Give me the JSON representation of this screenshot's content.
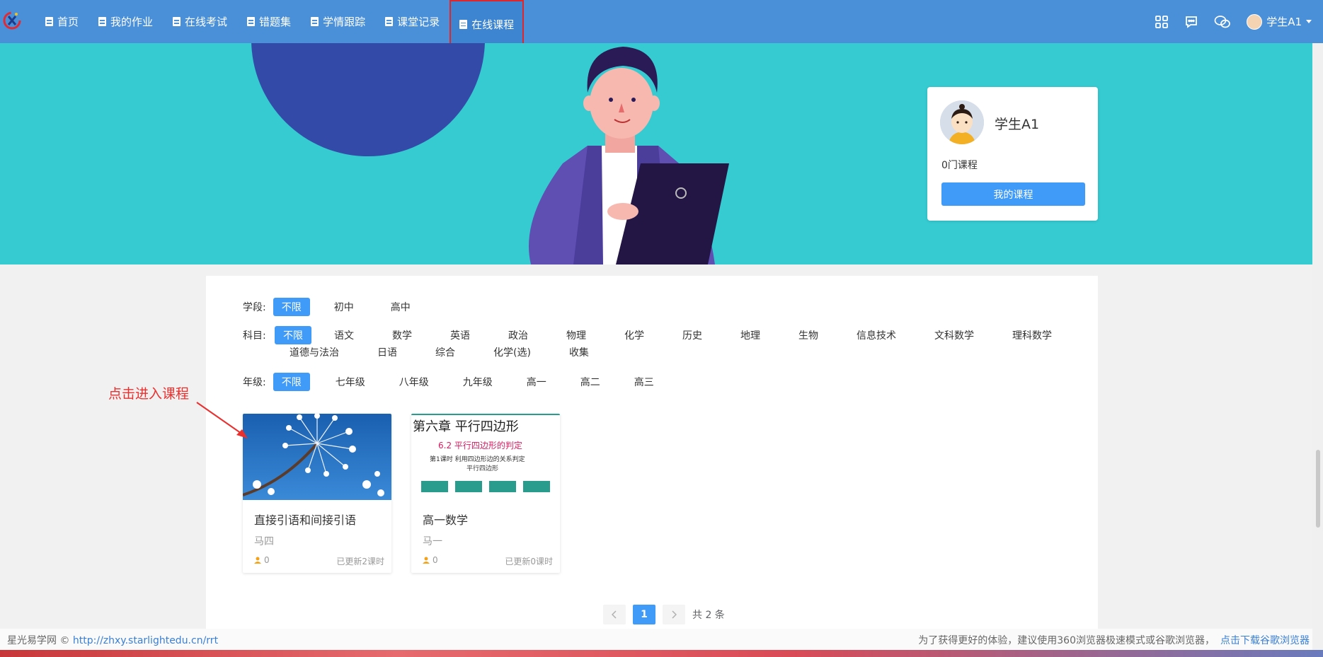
{
  "nav": {
    "items": [
      {
        "label": "首页"
      },
      {
        "label": "我的作业"
      },
      {
        "label": "在线考试"
      },
      {
        "label": "错题集"
      },
      {
        "label": "学情跟踪"
      },
      {
        "label": "课堂记录"
      },
      {
        "label": "在线课程",
        "active": true
      }
    ],
    "user_name": "学生A1"
  },
  "profile": {
    "name": "学生A1",
    "course_count": "0门课程",
    "my_courses_button": "我的课程"
  },
  "filters": {
    "stage": {
      "label": "学段:",
      "options": [
        "不限",
        "初中",
        "高中"
      ]
    },
    "subject": {
      "label": "科目:",
      "options": [
        "不限",
        "语文",
        "数学",
        "英语",
        "政治",
        "物理",
        "化学",
        "历史",
        "地理",
        "生物",
        "信息技术",
        "文科数学",
        "理科数学"
      ],
      "options_row2": [
        "道德与法治",
        "日语",
        "综合",
        "化学(选)",
        "收集"
      ]
    },
    "grade": {
      "label": "年级:",
      "options": [
        "不限",
        "七年级",
        "八年级",
        "九年级",
        "高一",
        "高二",
        "高三"
      ]
    }
  },
  "courses": [
    {
      "title": "直接引语和间接引语",
      "teacher": "马四",
      "students": "0",
      "updated": "已更新2课时"
    },
    {
      "title": "高一数学",
      "teacher": "马一",
      "students": "0",
      "updated": "已更新0课时",
      "thumb": {
        "heading": "第六章  平行四边形",
        "sub": "6.2  平行四边形的判定",
        "line1": "第1课时  利用四边形边的关系判定",
        "line2": "平行四边形"
      }
    }
  ],
  "pager": {
    "current": "1",
    "total": "共 2 条"
  },
  "annotation": "点击进入课程",
  "footer": {
    "copyright": "星光易学网 © ",
    "url": "http://zhxy.starlightedu.cn/rrt",
    "tip": "为了获得更好的体验，建议使用360浏览器极速模式或谷歌浏览器，",
    "download": "点击下载谷歌浏览器"
  },
  "colors": {
    "nav": "#4a90d9",
    "banner": "#35cbd1",
    "accent": "#3f9af8",
    "annotation": "#e8302f"
  }
}
